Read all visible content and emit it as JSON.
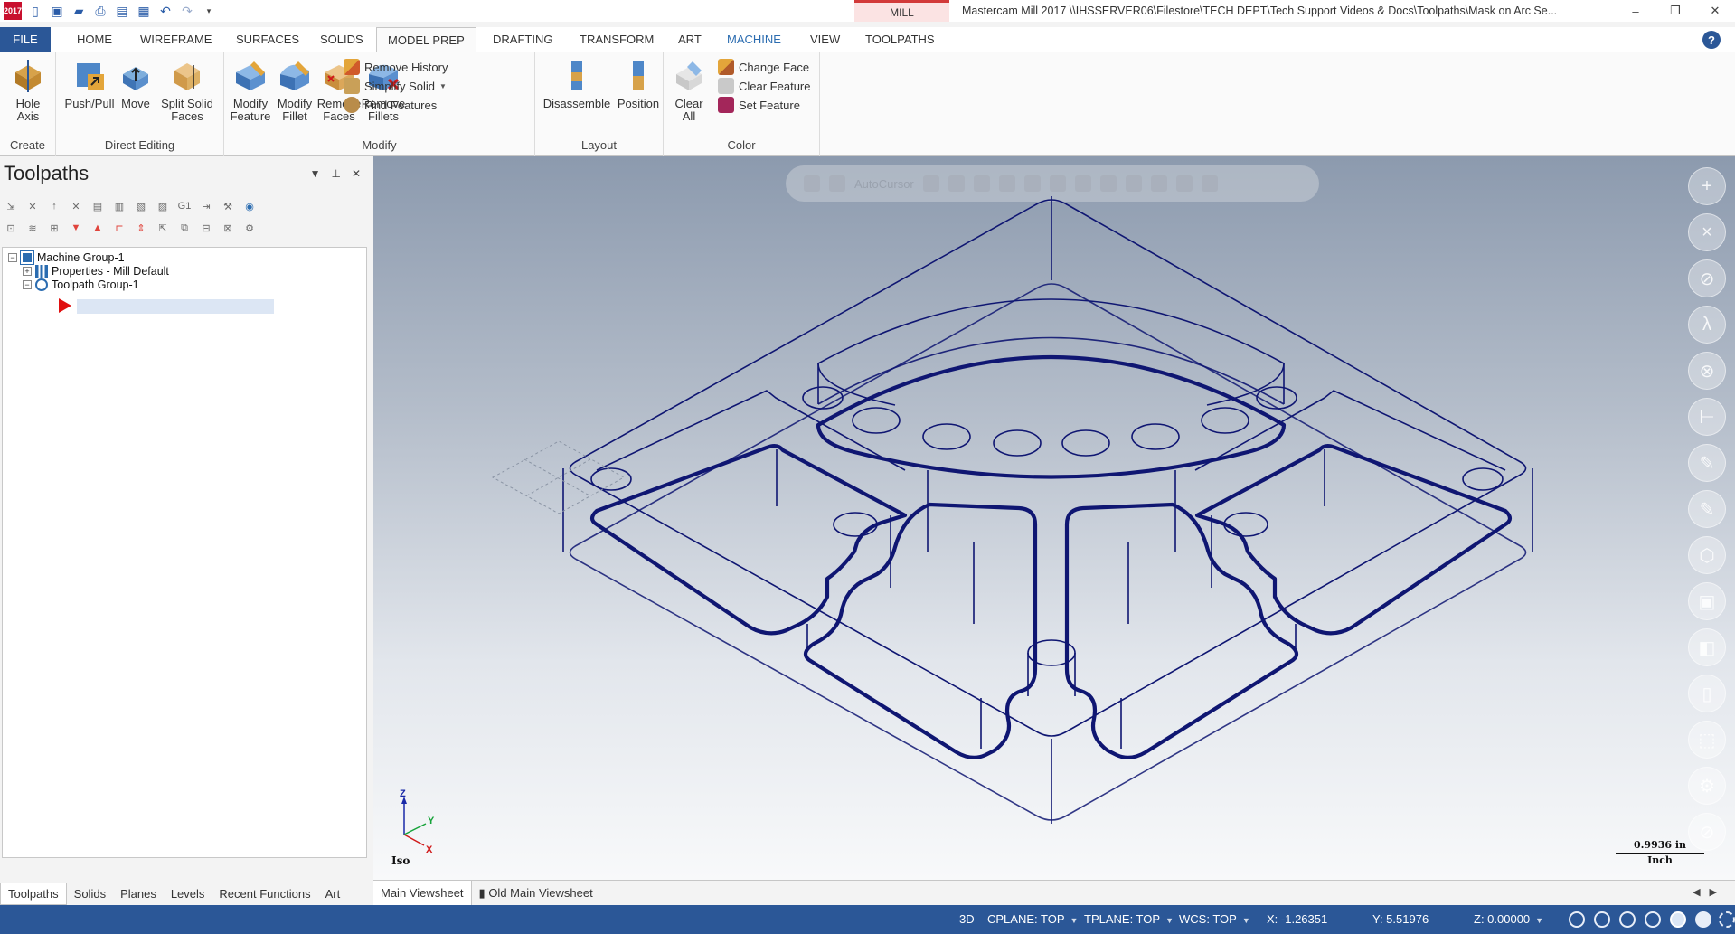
{
  "app": {
    "logo_text": "2017",
    "context_tab": "MILL",
    "window_title": "Mastercam Mill 2017  \\\\IHSSERVER06\\Filestore\\TECH DEPT\\Tech Support Videos & Docs\\Toolpaths\\Mask on Arc Se..."
  },
  "window_controls": {
    "minimize": "–",
    "restore": "❐",
    "close": "✕"
  },
  "ribbon_tabs": [
    "FILE",
    "HOME",
    "WIREFRAME",
    "SURFACES",
    "SOLIDS",
    "MODEL PREP",
    "DRAFTING",
    "TRANSFORM",
    "ART",
    "MACHINE",
    "VIEW",
    "TOOLPATHS"
  ],
  "active_tab": "MODEL PREP",
  "help_label": "?",
  "ribbon": {
    "create": {
      "label": "Create",
      "hole_axis": "Hole Axis"
    },
    "direct_editing": {
      "label": "Direct Editing",
      "push_pull": "Push/Pull",
      "move": "Move",
      "split_solid_faces": "Split Solid Faces"
    },
    "modify": {
      "label": "Modify",
      "modify_feature": "Modify Feature",
      "modify_fillet": "Modify Fillet",
      "remove_faces": "Remove Faces",
      "remove_fillets": "Remove Fillets",
      "remove_history": "Remove History",
      "simplify_solid": "Simplify Solid",
      "find_features": "Find Features"
    },
    "layout": {
      "label": "Layout",
      "disassemble": "Disassemble",
      "position": "Position"
    },
    "color": {
      "label": "Color",
      "clear_all": "Clear All",
      "change_face": "Change Face",
      "clear_feature": "Clear Feature",
      "set_feature": "Set Feature"
    }
  },
  "panel": {
    "title": "Toolpaths",
    "controls": {
      "dropdown": "▼",
      "pin": "⊥",
      "close": "✕"
    },
    "tree": {
      "machine_group": "Machine Group-1",
      "properties": "Properties - Mill Default",
      "toolpath_group": "Toolpath Group-1"
    },
    "bottom_tabs": [
      "Toolpaths",
      "Solids",
      "Planes",
      "Levels",
      "Recent Functions",
      "Art"
    ]
  },
  "viewport": {
    "autocursor_label": "AutoCursor",
    "view_label": "Iso",
    "scale_value": "0.9936 in",
    "scale_unit": "Inch",
    "triad": {
      "z": "Z",
      "y": "Y",
      "x": "X"
    }
  },
  "viewsheets": [
    "Main Viewsheet",
    "Old Main Viewsheet"
  ],
  "status": {
    "mode": "3D",
    "cplane": "CPLANE: TOP",
    "tplane": "TPLANE: TOP",
    "wcs": "WCS: TOP",
    "x": "X:   -1.26351",
    "y": "Y:   5.51976",
    "z": "Z:   0.00000"
  },
  "colors": {
    "accent": "#2b5797",
    "wire": "#0f1672",
    "insert_arrow": "#e01010",
    "context_tab": "#d23a3a"
  }
}
